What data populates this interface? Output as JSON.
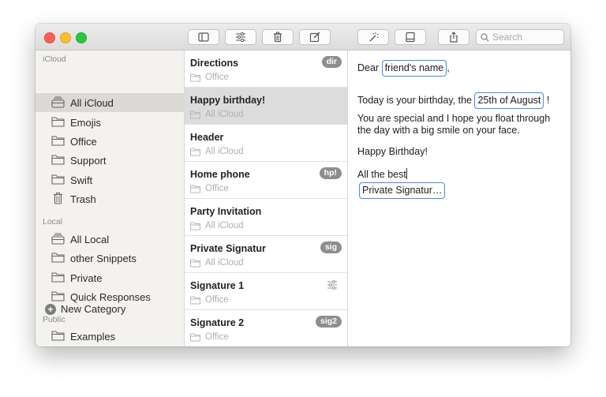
{
  "toolbar": {
    "search_placeholder": "Search",
    "buttons": [
      "sidebar-toggle-icon",
      "options-sliders-icon",
      "trash-icon",
      "compose-icon",
      "magic-wand-icon",
      "preview-pane-icon",
      "share-icon"
    ]
  },
  "sidebar": {
    "sections": [
      {
        "title": "iCloud",
        "items": [
          {
            "label": "All iCloud",
            "icon": "tray-stack-icon",
            "selected": true
          },
          {
            "label": "Emojis",
            "icon": "folder-icon"
          },
          {
            "label": "Office",
            "icon": "folder-icon"
          },
          {
            "label": "Support",
            "icon": "folder-icon"
          },
          {
            "label": "Swift",
            "icon": "folder-icon"
          },
          {
            "label": "Trash",
            "icon": "trash-icon"
          }
        ]
      },
      {
        "title": "Local",
        "items": [
          {
            "label": "All Local",
            "icon": "tray-stack-icon"
          },
          {
            "label": "other Snippets",
            "icon": "folder-icon"
          },
          {
            "label": "Private",
            "icon": "folder-icon"
          },
          {
            "label": "Quick Responses",
            "icon": "folder-icon"
          }
        ]
      },
      {
        "title": "Public",
        "items": [
          {
            "label": "Examples",
            "icon": "folder-icon"
          }
        ]
      }
    ],
    "new_category_label": "New Category"
  },
  "snippets": [
    {
      "title": "Directions",
      "folder": "Office",
      "badge": "dir"
    },
    {
      "title": "Happy birthday!",
      "folder": "All iCloud",
      "badge": "",
      "selected": true
    },
    {
      "title": "Header",
      "folder": "All iCloud",
      "badge": ""
    },
    {
      "title": "Home phone",
      "folder": "Office",
      "badge": "hp!"
    },
    {
      "title": "Party Invitation",
      "folder": "All iCloud",
      "badge": ""
    },
    {
      "title": "Private Signatur",
      "folder": "All iCloud",
      "badge": "sig"
    },
    {
      "title": "Signature 1",
      "folder": "Office",
      "badge": "",
      "options_icon": true
    },
    {
      "title": "Signature 2",
      "folder": "Office",
      "badge": "sig2"
    }
  ],
  "editor": {
    "line1_prefix": "Dear",
    "token_name": "friend's name",
    "line1_suffix": ",",
    "line2_prefix": "Today is your birthday, the",
    "token_date": "25th of August",
    "line2_suffix": "!",
    "line3": "You are special and I hope you float through",
    "line4": "the day with a big smile on your face.",
    "line5": "Happy Birthday!",
    "line6": "All the best",
    "token_signature": "Private Signatur…"
  },
  "colors": {
    "token_border": "#3f8cf0",
    "selected_row": "#dcdcdc",
    "sidebar_bg": "#f4f2ef",
    "badge_bg": "#8e8e8e"
  }
}
